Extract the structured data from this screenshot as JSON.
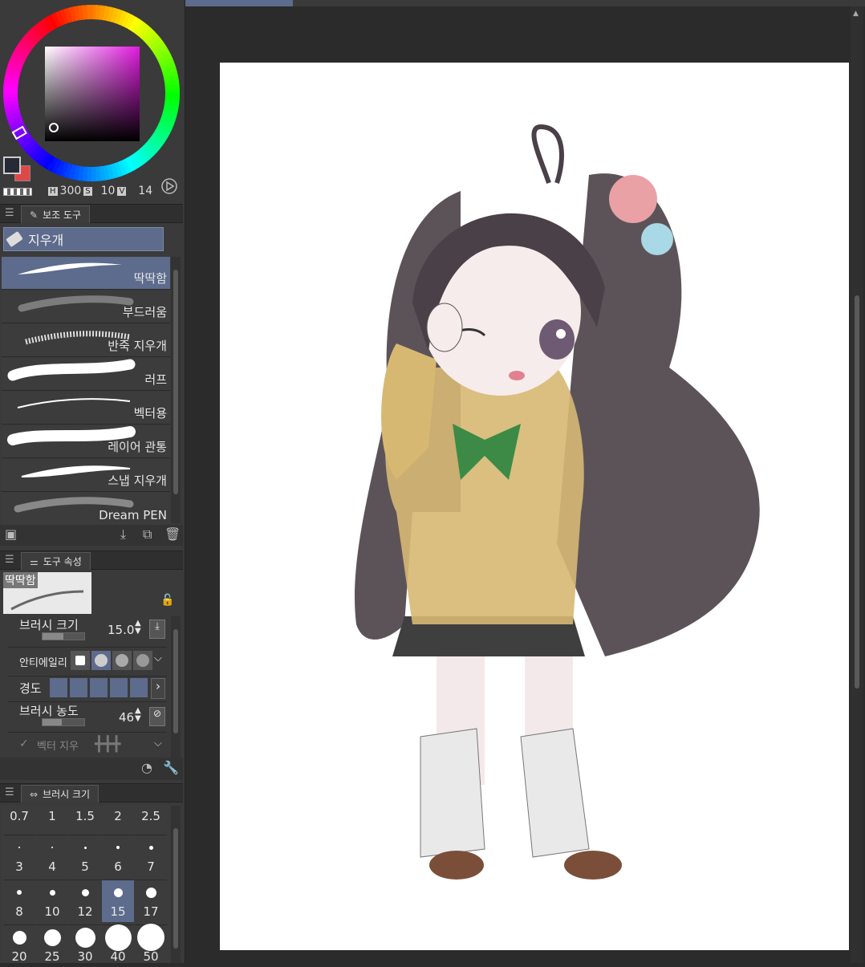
{
  "color_panel": {
    "hsv": {
      "h_label": "H",
      "h": "300",
      "s_label": "S",
      "s": "10",
      "v_label": "V",
      "v": "14"
    }
  },
  "sub_tool_panel": {
    "tab_label": "보조 도구",
    "group_label": "지우개",
    "items": [
      {
        "label": "딱딱함"
      },
      {
        "label": "부드러움"
      },
      {
        "label": "반죽 지우개"
      },
      {
        "label": "러프"
      },
      {
        "label": "벡터용"
      },
      {
        "label": "레이어 관통"
      },
      {
        "label": "스냅 지우개"
      },
      {
        "label": "Dream PEN"
      }
    ]
  },
  "tool_property_panel": {
    "tab_label": "도구 속성",
    "preview_label": "딱딱함",
    "brush_size_label": "브러시 크기",
    "brush_size_value": "15.0",
    "antialias_label": "안티에일리",
    "hardness_label": "경도",
    "density_label": "브러시 농도",
    "density_value": "46",
    "vector_label": "벡터 지우"
  },
  "brush_size_panel": {
    "tab_label": "브러시 크기",
    "selected": "15",
    "sizes": [
      "0.7",
      "1",
      "1.5",
      "2",
      "2.5",
      "3",
      "4",
      "5",
      "6",
      "7",
      "8",
      "10",
      "12",
      "15",
      "17",
      "20",
      "25",
      "30",
      "40",
      "50"
    ]
  },
  "colors": {
    "selection": "#5d6b8c",
    "panel_bg": "#3a3a3a",
    "canvas_bg": "#2b2b2b"
  }
}
